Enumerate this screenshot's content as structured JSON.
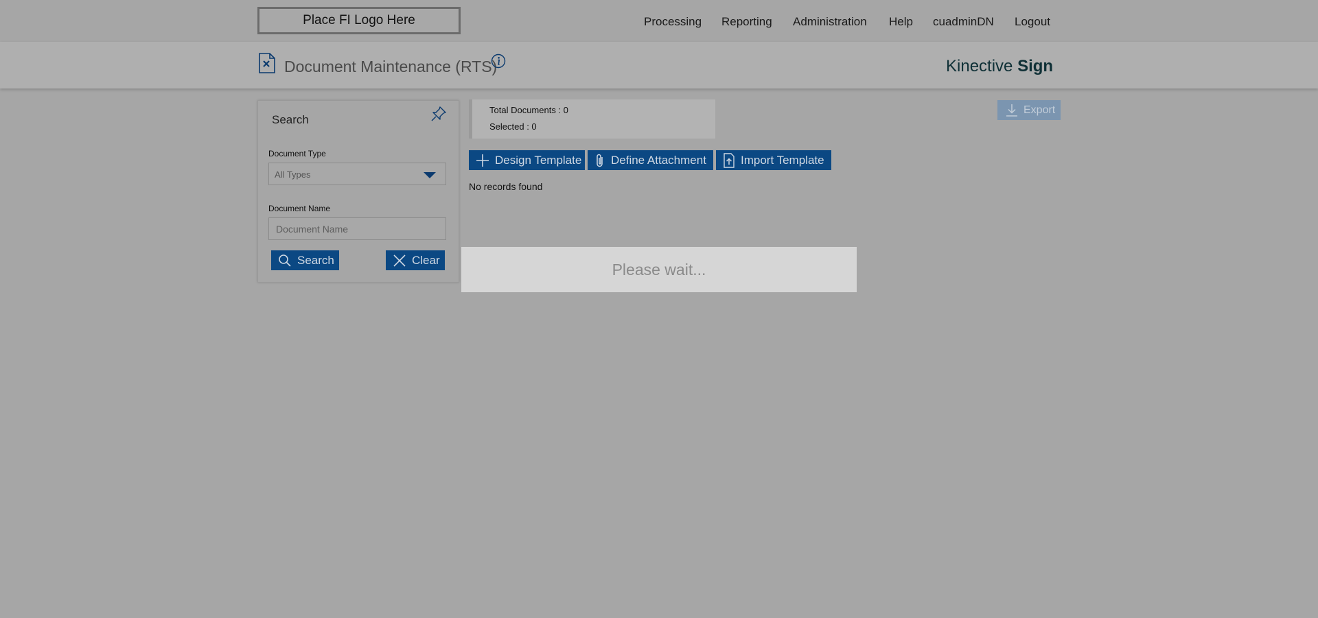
{
  "header": {
    "logo_text": "Place FI Logo Here",
    "nav": [
      "Processing",
      "Reporting",
      "Administration",
      "Help",
      "cuadminDN",
      "Logout"
    ]
  },
  "subheader": {
    "title": "Document Maintenance (RTS)",
    "brand_light": "Kinective",
    "brand_bold": "Sign"
  },
  "search_panel": {
    "title": "Search",
    "document_type_label": "Document Type",
    "document_type_value": "All Types",
    "document_name_label": "Document Name",
    "document_name_placeholder": "Document Name",
    "search_label": "Search",
    "clear_label": "Clear"
  },
  "stats": {
    "total_documents": "Total Documents : 0",
    "selected": "Selected : 0"
  },
  "toolbar": {
    "design_template": "Design Template",
    "define_attachment": "Define Attachment",
    "import_template": "Import Template",
    "export": "Export"
  },
  "results": {
    "empty_message": "No records found"
  },
  "overlay": {
    "message": "Please wait..."
  },
  "colors": {
    "accent": "#0b4883",
    "overlay_bg": "#a6a6a6"
  }
}
